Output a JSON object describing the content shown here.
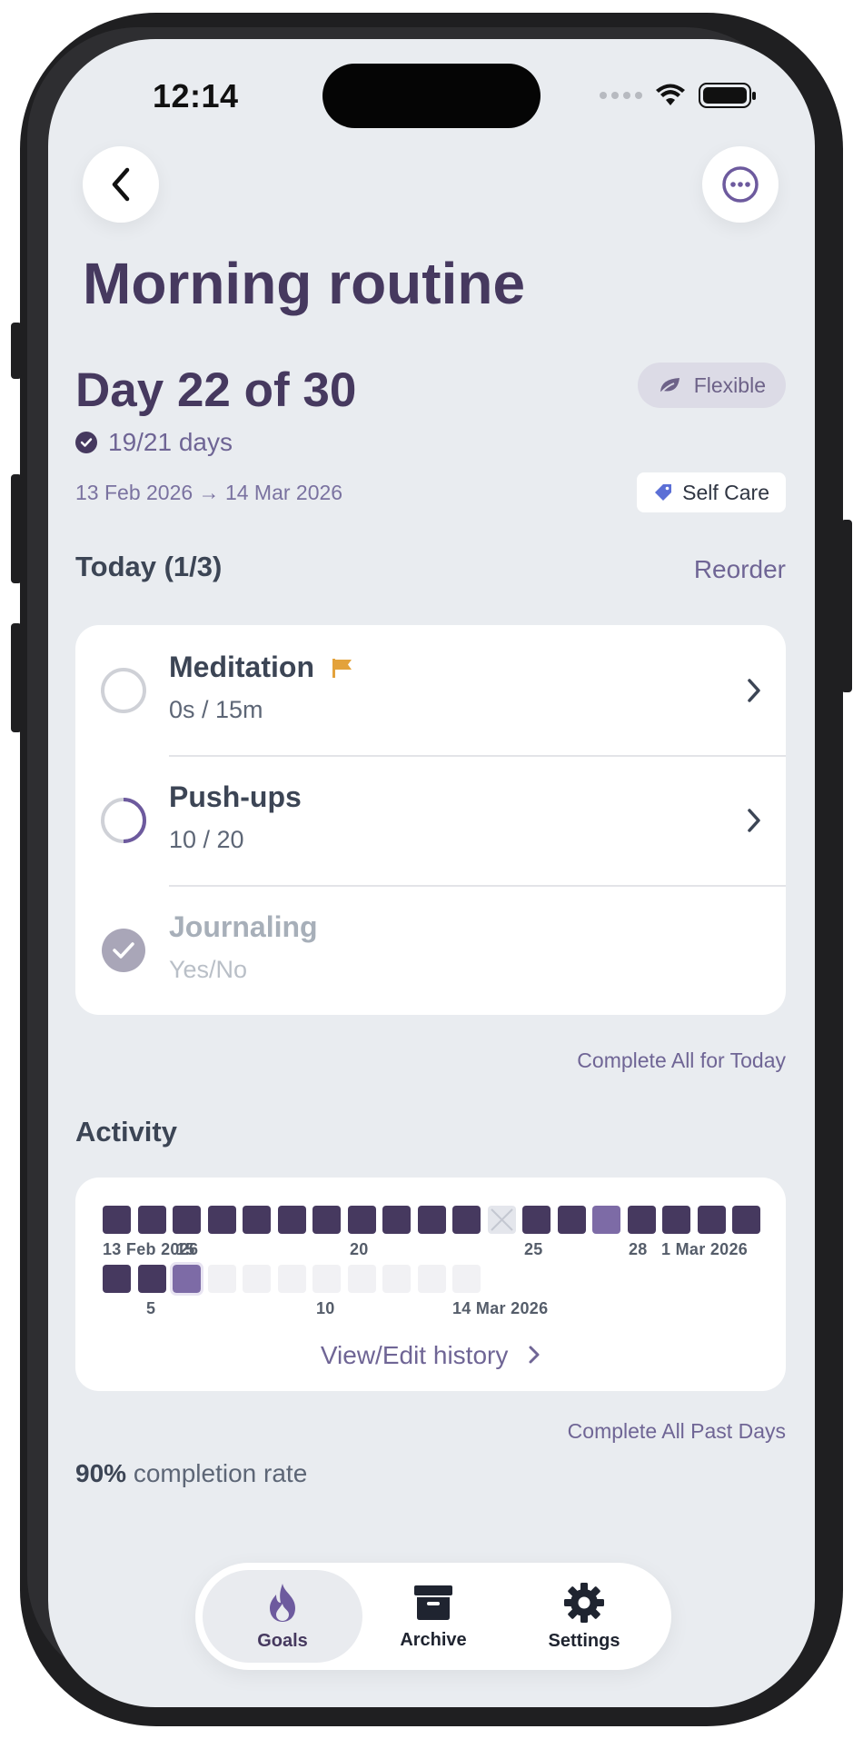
{
  "status_bar": {
    "time": "12:14"
  },
  "page": {
    "title": "Morning routine",
    "day_progress": "Day 22 of 30",
    "mode_badge": "Flexible",
    "days_completed": "19/21 days",
    "date_range": "13 Feb 2026 → 14 Mar 2026",
    "category": "Self Care"
  },
  "today": {
    "header": "Today (1/3)",
    "reorder_label": "Reorder",
    "tasks": [
      {
        "name": "Meditation",
        "detail": "0s / 15m",
        "progress": 0,
        "flagged": true,
        "done": false
      },
      {
        "name": "Push-ups",
        "detail": "10 / 20",
        "progress": 0.5,
        "flagged": false,
        "done": false
      },
      {
        "name": "Journaling",
        "detail": "Yes/No",
        "progress": 1,
        "flagged": false,
        "done": true
      }
    ],
    "complete_all_label": "Complete All for Today"
  },
  "activity": {
    "header": "Activity",
    "row1_labels": [
      "13 Feb 2026",
      "15",
      "20",
      "25",
      "28",
      "1 Mar 2026"
    ],
    "row2_labels": [
      "5",
      "10",
      "14 Mar 2026"
    ],
    "row1_states": [
      "done",
      "done",
      "done",
      "done",
      "done",
      "done",
      "done",
      "done",
      "done",
      "done",
      "done",
      "missed",
      "done",
      "done",
      "partial",
      "done",
      "done",
      "done",
      "done"
    ],
    "row2_states": [
      "done",
      "done",
      "today",
      "future",
      "future",
      "future",
      "future",
      "future",
      "future",
      "future",
      "future"
    ],
    "view_history_label": "View/Edit history",
    "complete_past_label": "Complete All Past Days"
  },
  "stats": {
    "completion_percent": "90%",
    "completion_label": "completion rate"
  },
  "tabs": [
    {
      "label": "Goals",
      "icon": "flame-icon",
      "active": true
    },
    {
      "label": "Archive",
      "icon": "archive-icon",
      "active": false
    },
    {
      "label": "Settings",
      "icon": "gear-icon",
      "active": false
    }
  ],
  "colors": {
    "primary": "#46395f",
    "accent": "#7d6ba6",
    "flag": "#e3a23b",
    "category_tag": "#5b6fd6",
    "background": "#e9ecf0"
  }
}
